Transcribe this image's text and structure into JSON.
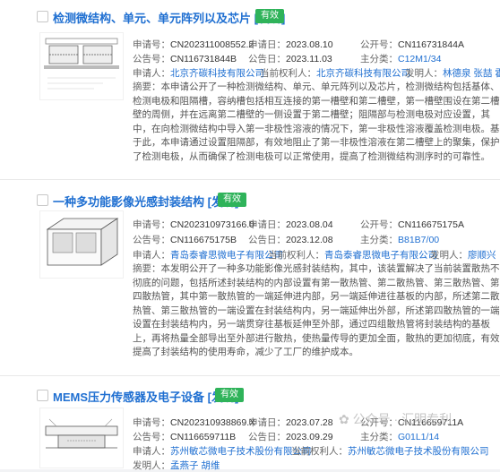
{
  "results": [
    {
      "title": "检测微结构、单元、单元阵列以及芯片 [发明]",
      "status": "有效",
      "fields": {
        "app_no_label": "申请号：",
        "app_no": "CN202311008552.2",
        "app_date_label": "申请日：",
        "app_date": "2023.08.10",
        "pub_no_label": "公开号：",
        "pub_no": "CN116731844A",
        "grant_no_label": "公告号：",
        "grant_no": "CN116731844B",
        "grant_date_label": "公告日：",
        "grant_date": "2023.11.03",
        "main_class_label": "主分类：",
        "main_class": "C12M1/34",
        "applicant_label": "申请人：",
        "applicant": "北京齐碳科技有限公司",
        "owner_label": "当前权利人：",
        "owner": "北京齐碳科技有限公司",
        "inventor_label": "发明人：",
        "inventor": "林德泉  张喆  霍伟"
      },
      "abstract_label": "摘要：",
      "abstract": "本申请公开了一种检测微结构、单元、单元阵列以及芯片，检测微结构包括基体、检测电极和阻隔槽，容纳槽包括相互连接的第一槽壁和第二槽壁，第一槽壁围设在第二槽壁的周侧，并在远离第二槽壁的一侧设置于第二槽壁；阻隔部与检测电极对应设置，其中，在向检测微结构中导入第一非极性溶液的情况下，第一非极性溶液覆盖检测电极。基于此，本申请通过设置阻隔部，有效地阻止了第一非极性溶液在第二槽壁上的聚集，保护了检测电极，从而确保了检测电极可以正常使用，提高了检测微结构测序时的可靠性。"
    },
    {
      "title": "一种多功能影像光感封装结构 [发明]",
      "status": "有效",
      "fields": {
        "app_no_label": "申请号：",
        "app_no": "CN202310973166.0",
        "app_date_label": "申请日：",
        "app_date": "2023.08.04",
        "pub_no_label": "公开号：",
        "pub_no": "CN116675175A",
        "grant_no_label": "公告号：",
        "grant_no": "CN116675175B",
        "grant_date_label": "公告日：",
        "grant_date": "2023.12.08",
        "main_class_label": "主分类：",
        "main_class": "B81B7/00",
        "applicant_label": "申请人：",
        "applicant": "青岛泰睿思微电子有限公司",
        "owner_label": "当前权利人：",
        "owner": "青岛泰睿思微电子有限公司",
        "inventor_label": "发明人：",
        "inventor": "廖顺兴"
      },
      "abstract_label": "摘要：",
      "abstract": "本发明公开了一种多功能影像光感封装结构，其中，该装置解决了当前装置散热不彻底的问题，包括所述封装结构的内部设置有第一散热管、第二散热管、第三散热管、第四散热管，其中第一散热管的一端延伸进内部，另一端延伸进往基板的内部，所述第二散热管、第三散热管的一端设置在封装结构内，另一端延伸出外部，所述第四散热管的一端设置在封装结构内，另一端贯穿往基板延伸至外部，通过四组散热管将封装结构的基板上，再将热量全部导出至外部进行散热，使热量传导的更加全面，散热的更加彻底，有效提高了封装结构的使用寿命，减少了工厂的维护成本。"
    },
    {
      "title": "MEMS压力传感器及电子设备 [发明]",
      "status": "有效",
      "fields": {
        "app_no_label": "申请号：",
        "app_no": "CN202310938869.X",
        "app_date_label": "申请日：",
        "app_date": "2023.07.28",
        "pub_no_label": "公开号：",
        "pub_no": "CN116659711A",
        "grant_no_label": "公告号：",
        "grant_no": "CN116659711B",
        "grant_date_label": "公告日：",
        "grant_date": "2023.09.29",
        "main_class_label": "主分类：",
        "main_class": "G01L1/14",
        "applicant_label": "申请人：",
        "applicant": "苏州敏芯微电子技术股份有限公司",
        "owner_label": "当前权利人：",
        "owner": "苏州敏芯微电子技术股份有限公司",
        "inventor_label": "发明人：",
        "inventor": "孟燕子  胡维"
      }
    }
  ],
  "watermark": "公众号 · 汇明专利",
  "colors": {
    "link": "#1f6fd1",
    "badge": "#2fb35a"
  },
  "icons": [
    "checkbox",
    "patent-drawing-thumbnail",
    "wechat-icon"
  ]
}
